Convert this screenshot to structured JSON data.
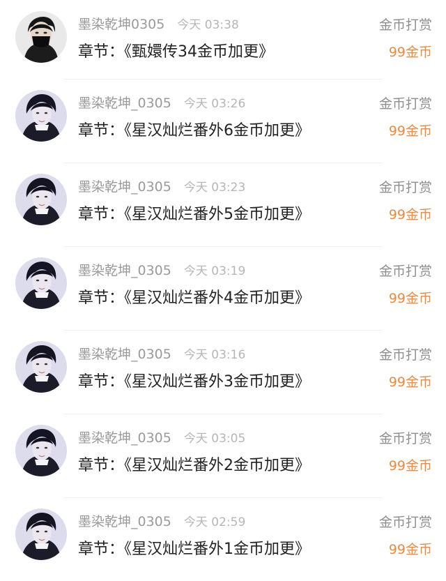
{
  "colors": {
    "username": "#9a9a9a",
    "time": "#b6b6b6",
    "chapter_text": "#222222",
    "reward_label": "#8e8e8e",
    "reward_amount": "#ef8a3c"
  },
  "rewards": [
    {
      "avatar": "avatar-masked-portrait",
      "username": "墨染乾坤0305",
      "time": "今天 03:38",
      "chapter": "章节：《甄嬛传34金币加更》",
      "reward_label": "金币打赏",
      "amount": "99金币"
    },
    {
      "avatar": "avatar-portrait",
      "username": "墨染乾坤_0305",
      "time": "今天 03:26",
      "chapter": "章节：《星汉灿烂番外6金币加更》",
      "reward_label": "金币打赏",
      "amount": "99金币"
    },
    {
      "avatar": "avatar-portrait",
      "username": "墨染乾坤_0305",
      "time": "今天 03:23",
      "chapter": "章节：《星汉灿烂番外5金币加更》",
      "reward_label": "金币打赏",
      "amount": "99金币"
    },
    {
      "avatar": "avatar-portrait",
      "username": "墨染乾坤_0305",
      "time": "今天 03:19",
      "chapter": "章节：《星汉灿烂番外4金币加更》",
      "reward_label": "金币打赏",
      "amount": "99金币"
    },
    {
      "avatar": "avatar-portrait",
      "username": "墨染乾坤_0305",
      "time": "今天 03:16",
      "chapter": "章节：《星汉灿烂番外3金币加更》",
      "reward_label": "金币打赏",
      "amount": "99金币"
    },
    {
      "avatar": "avatar-portrait",
      "username": "墨染乾坤_0305",
      "time": "今天 03:05",
      "chapter": "章节：《星汉灿烂番外2金币加更》",
      "reward_label": "金币打赏",
      "amount": "99金币"
    },
    {
      "avatar": "avatar-portrait",
      "username": "墨染乾坤_0305",
      "time": "今天 02:59",
      "chapter": "章节：《星汉灿烂番外1金币加更》",
      "reward_label": "金币打赏",
      "amount": "99金币"
    }
  ]
}
